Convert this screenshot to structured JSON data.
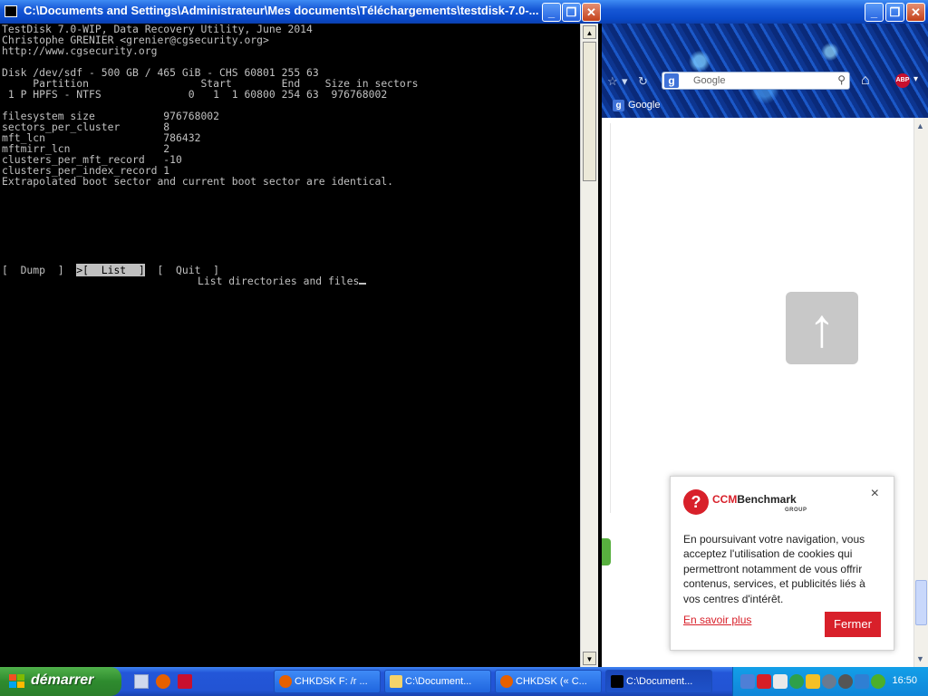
{
  "console": {
    "title": "C:\\Documents and Settings\\Administrateur\\Mes documents\\Téléchargements\\testdisk-7.0-...",
    "lines": [
      "TestDisk 7.0-WIP, Data Recovery Utility, June 2014",
      "Christophe GRENIER <grenier@cgsecurity.org>",
      "http://www.cgsecurity.org",
      "",
      "Disk /dev/sdf - 500 GB / 465 GiB - CHS 60801 255 63",
      "     Partition                  Start        End    Size in sectors",
      " 1 P HPFS - NTFS              0   1  1 60800 254 63  976768002",
      "",
      "filesystem size           976768002",
      "sectors_per_cluster       8",
      "mft_lcn                   786432",
      "mftmirr_lcn               2",
      "clusters_per_mft_record   -10",
      "clusters_per_index_record 1",
      "Extrapolated boot sector and current boot sector are identical."
    ],
    "menu": {
      "dump": "[  Dump  ]",
      "list": ">[  List  ]",
      "quit": "[  Quit  ]"
    },
    "hint": "List directories and files"
  },
  "browser": {
    "search_placeholder": "Google",
    "bookmark_label": "Google",
    "abp_label": "ABP"
  },
  "cookie": {
    "brand_ccm": "CCM",
    "brand_rest": "Benchmark",
    "brand_group": "GROUP",
    "close_glyph": "×",
    "message": "En poursuivant votre navigation, vous acceptez l'utilisation de cookies qui permettront notamment de vous offrir contenus, services, et publicités liés à vos centres d'intérêt.",
    "more_label": "En savoir plus",
    "fermer_label": "Fermer"
  },
  "taskbar": {
    "start_label": "démarrer",
    "tasks": [
      {
        "label": "CHKDSK F: /r ...",
        "icon": "firefox-icon",
        "color": "#e66000"
      },
      {
        "label": "C:\\Document...",
        "icon": "folder-icon",
        "color": "#f5d36a"
      },
      {
        "label": "CHKDSK (« C...",
        "icon": "firefox-icon",
        "color": "#e66000"
      },
      {
        "label": "C:\\Document...",
        "icon": "console-icon",
        "color": "#000000"
      }
    ],
    "clock": "16:50"
  }
}
